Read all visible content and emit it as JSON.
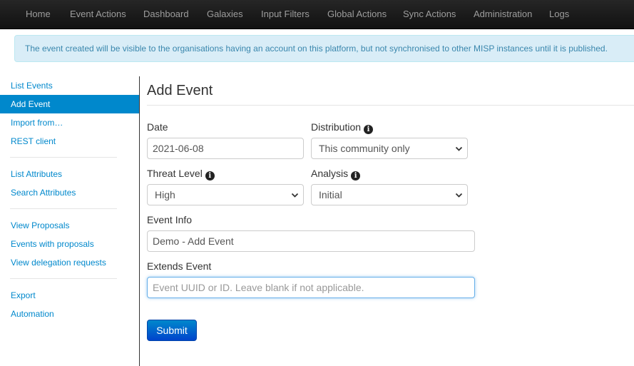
{
  "topnav": {
    "items": [
      "Home",
      "Event Actions",
      "Dashboard",
      "Galaxies",
      "Input Filters",
      "Global Actions",
      "Sync Actions",
      "Administration",
      "Logs"
    ]
  },
  "alert": {
    "text": "The event created will be visible to the organisations having an account on this platform, but not synchronised to other MISP instances until it is published."
  },
  "sidebar": {
    "items": [
      "List Events",
      "Add Event",
      "Import from…",
      "REST client",
      "List Attributes",
      "Search Attributes",
      "View Proposals",
      "Events with proposals",
      "View delegation requests",
      "Export",
      "Automation"
    ],
    "active": "Add Event"
  },
  "form": {
    "title": "Add Event",
    "date_label": "Date",
    "date_value": "2021-06-08",
    "distribution_label": "Distribution",
    "distribution_value": "This community only",
    "threat_label": "Threat Level",
    "threat_value": "High",
    "analysis_label": "Analysis",
    "analysis_value": "Initial",
    "info_label": "Event Info",
    "info_value": "Demo - Add Event",
    "extends_label": "Extends Event",
    "extends_placeholder": "Event UUID or ID. Leave blank if not applicable.",
    "submit_label": "Submit"
  },
  "icons": {
    "info": "info-circle-icon",
    "chevron": "chevron-down-icon"
  },
  "colors": {
    "link": "#0088cc",
    "alert_bg": "#d9edf7",
    "alert_text": "#3a87ad",
    "navbar": "#1f1f1f",
    "primary": "#0088cc"
  }
}
